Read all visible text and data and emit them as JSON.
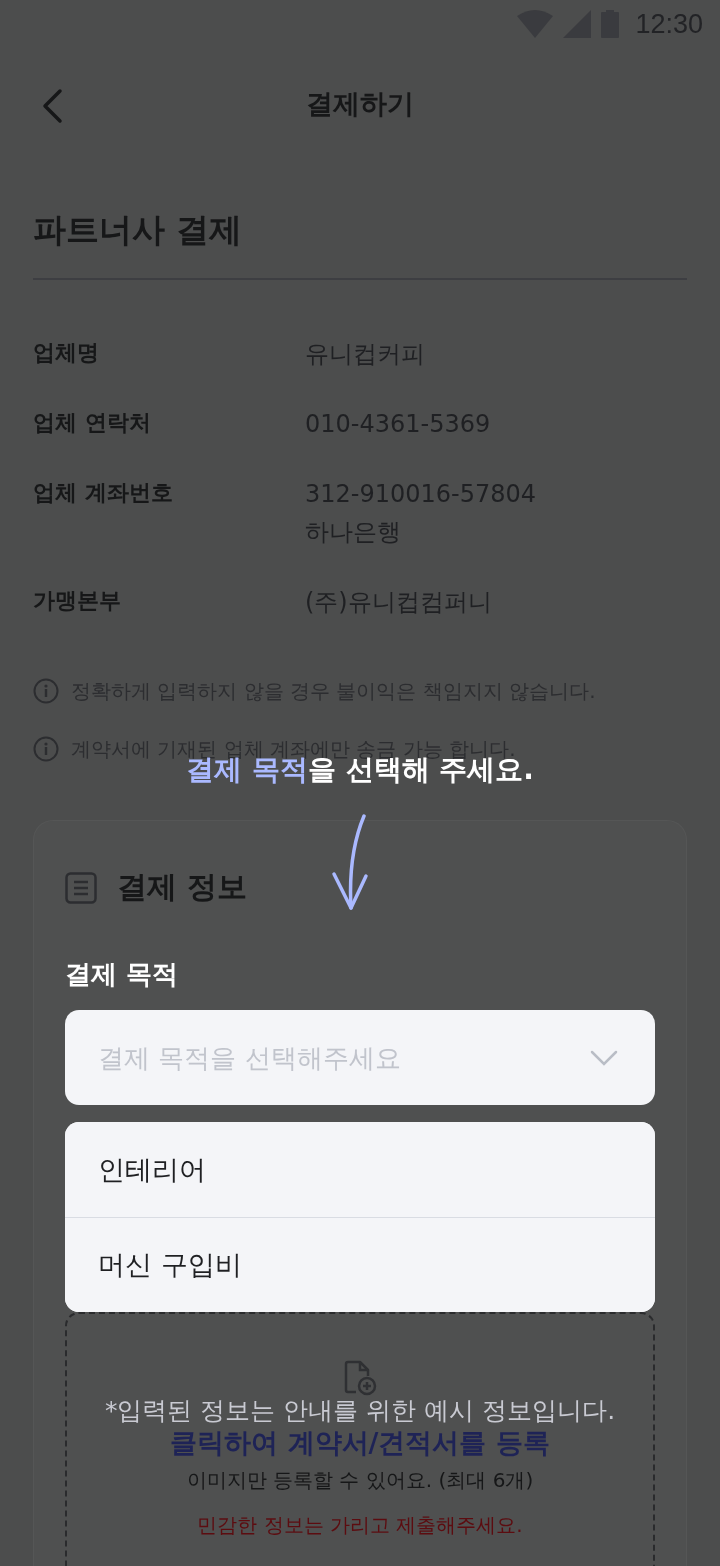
{
  "status_bar": {
    "time": "12:30"
  },
  "header": {
    "title": "결제하기"
  },
  "partner": {
    "title": "파트너사 결제",
    "rows": [
      {
        "label": "업체명",
        "lines": [
          "유니컵커피"
        ]
      },
      {
        "label": "업체 연락처",
        "lines": [
          "010-4361-5369"
        ]
      },
      {
        "label": "업체 계좌번호",
        "lines": [
          "312-910016-57804",
          "하나은행"
        ]
      },
      {
        "label": "가맹본부",
        "lines": [
          "(주)유니컵컴퍼니"
        ]
      }
    ]
  },
  "notices": [
    "정확하게 입력하지 않을 경우 불이익은 책임지지 않습니다.",
    "계약서에 기재된 업체 계좌에만 송금 가능 합니다."
  ],
  "card": {
    "title": "결제 정보",
    "field_label": "결제 목적",
    "dropdown": {
      "placeholder": "결제 목적을 선택해주세요",
      "expanded": true
    },
    "options": [
      {
        "label": "인테리어",
        "selected": false
      },
      {
        "label": "머신 구입비",
        "selected": false
      }
    ],
    "upload": {
      "link": "클릭하여 계약서/견적서를 등록",
      "hint": "이미지만 등록할 수 있어요. (최대 6개)",
      "warning": "민감한 정보는 가리고 제출해주세요."
    }
  },
  "coach": {
    "text": "**결제 목적**을 선택해 주세요.",
    "footnote": "*입력된 정보는 안내를 위한 예시 정보입니다."
  }
}
